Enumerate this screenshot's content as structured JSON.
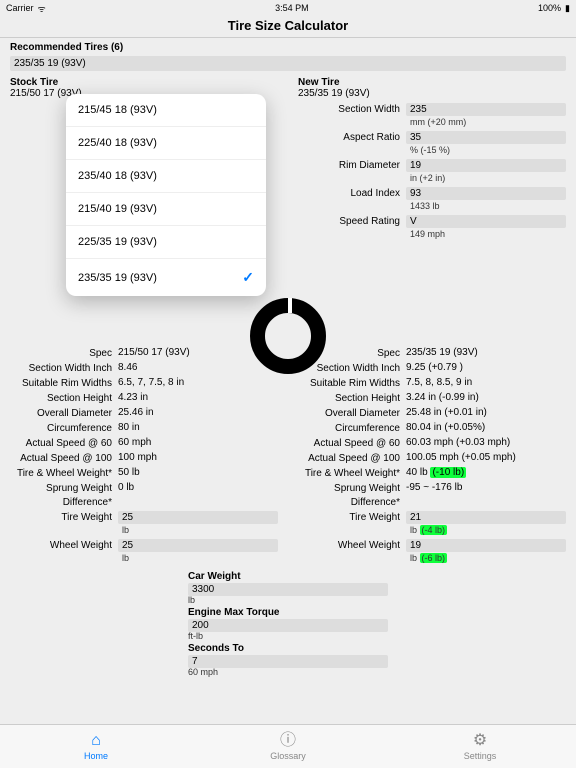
{
  "status": {
    "carrier": "Carrier",
    "wifi": "ᯤ",
    "time": "3:54 PM",
    "battery": "100%",
    "battIcon": "▮"
  },
  "title": "Tire Size Calculator",
  "recommended": {
    "label": "Recommended Tires (6)",
    "selected": "235/35 19 (93V)"
  },
  "stock": {
    "header": "Stock Tire",
    "sub": "215/50 17 (93V)"
  },
  "newt": {
    "header": "New Tire",
    "sub": "235/35 19 (93V)"
  },
  "newInputs": {
    "sectionWidth": {
      "label": "Section Width",
      "value": "235",
      "sub": "mm (+20 mm)"
    },
    "aspectRatio": {
      "label": "Aspect Ratio",
      "value": "35",
      "sub": "% (-15 %)"
    },
    "rimDiameter": {
      "label": "Rim Diameter",
      "value": "19",
      "sub": "in (+2 in)"
    },
    "loadIndex": {
      "label": "Load Index",
      "value": "93",
      "sub": "1433 lb"
    },
    "speedRating": {
      "label": "Speed Rating",
      "value": "V",
      "sub": "149 mph"
    }
  },
  "dropdown": [
    {
      "label": "215/45 18 (93V)",
      "selected": false
    },
    {
      "label": "225/40 18 (93V)",
      "selected": false
    },
    {
      "label": "235/40 18 (93V)",
      "selected": false
    },
    {
      "label": "215/40 19 (93V)",
      "selected": false
    },
    {
      "label": "225/35 19 (93V)",
      "selected": false
    },
    {
      "label": "235/35 19 (93V)",
      "selected": true
    }
  ],
  "stockSpecs": [
    {
      "label": "Spec",
      "value": "215/50 17 (93V)"
    },
    {
      "label": "Section Width Inch",
      "value": "8.46"
    },
    {
      "label": "Suitable Rim Widths",
      "value": "6.5, 7, 7.5, 8 in"
    },
    {
      "label": "Section Height",
      "value": "4.23 in"
    },
    {
      "label": "Overall Diameter",
      "value": "25.46 in"
    },
    {
      "label": "Circumference",
      "value": "80 in"
    },
    {
      "label": "Actual Speed @ 60",
      "value": "60 mph"
    },
    {
      "label": "Actual Speed @ 100",
      "value": "100 mph"
    },
    {
      "label": "Tire & Wheel Weight*",
      "value": "50 lb"
    },
    {
      "label": "Sprung Weight Difference*",
      "value": "0 lb"
    }
  ],
  "stockBottom": {
    "tireWeight": {
      "label": "Tire Weight",
      "value": "25",
      "sub": "lb"
    },
    "wheelWeight": {
      "label": "Wheel Weight",
      "value": "25",
      "sub": "lb"
    }
  },
  "newSpecs": [
    {
      "label": "Spec",
      "value": "235/35 19 (93V)"
    },
    {
      "label": "Section Width Inch",
      "value": "9.25 (+0.79 )"
    },
    {
      "label": "Suitable Rim Widths",
      "value": "7.5, 8, 8.5, 9 in"
    },
    {
      "label": "Section Height",
      "value": "3.24 in (-0.99 in)"
    },
    {
      "label": "Overall Diameter",
      "value": "25.48 in (+0.01 in)"
    },
    {
      "label": "Circumference",
      "value": "80.04 in (+0.05%)"
    },
    {
      "label": "Actual Speed @ 60",
      "value": "60.03 mph (+0.03 mph)"
    },
    {
      "label": "Actual Speed @ 100",
      "value": "100.05 mph (+0.05 mph)"
    },
    {
      "label": "Tire & Wheel Weight*",
      "value": "40 lb ",
      "hl": "(-10 lb)"
    },
    {
      "label": "Sprung Weight Difference*",
      "value": "-95 ~ -176 lb"
    }
  ],
  "newBottom": {
    "tireWeight": {
      "label": "Tire Weight",
      "value": "21",
      "sub": "lb ",
      "hl": "(-4 lb)"
    },
    "wheelWeight": {
      "label": "Wheel Weight",
      "value": "19",
      "sub": "lb ",
      "hl": "(-6 lb)"
    }
  },
  "center": {
    "carWeight": {
      "label": "Car Weight",
      "value": "3300",
      "sub": "lb"
    },
    "engineTorque": {
      "label": "Engine Max Torque",
      "value": "200",
      "sub": "ft-lb"
    },
    "secondsTo": {
      "label": "Seconds To",
      "value": "7",
      "sub": "60 mph"
    }
  },
  "tabs": {
    "home": "Home",
    "glossary": "Glossary",
    "settings": "Settings"
  }
}
